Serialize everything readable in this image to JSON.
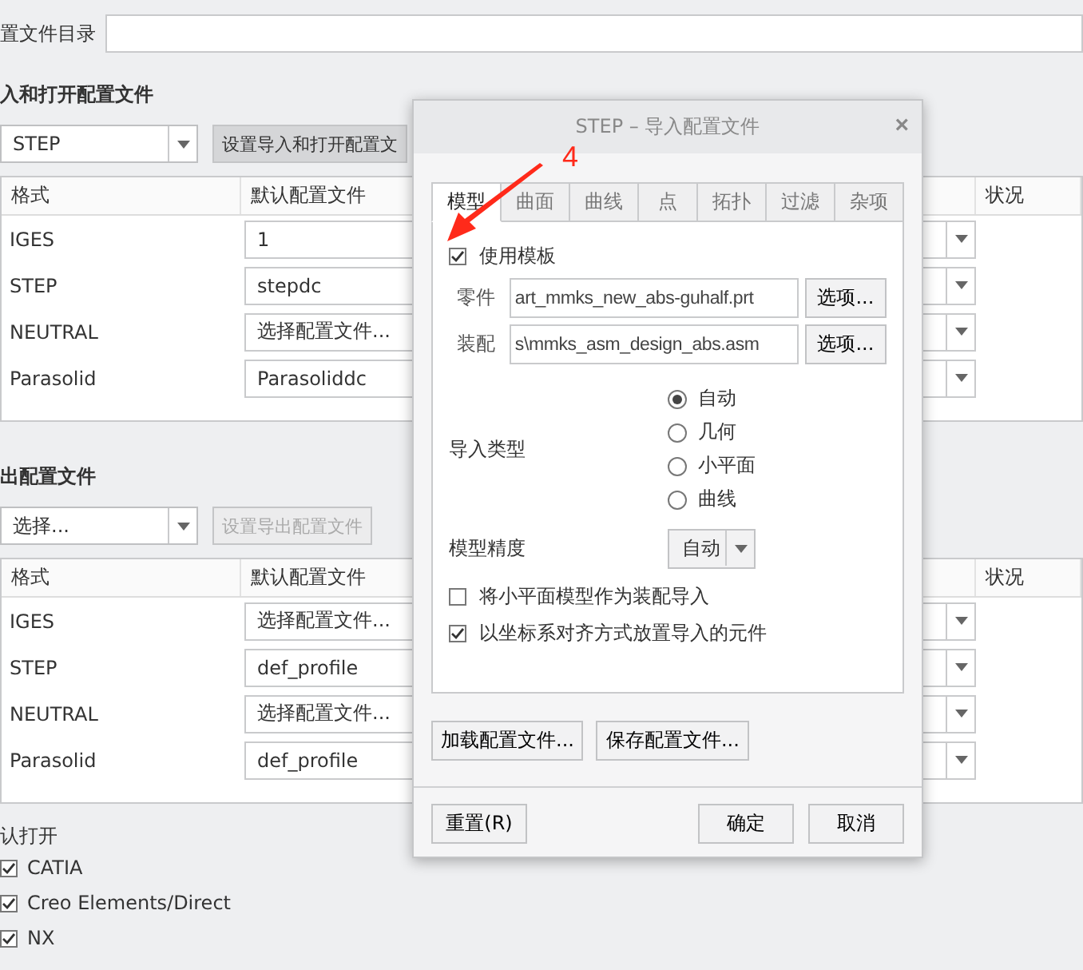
{
  "background": {
    "directory_label": "置文件目录",
    "import_section": {
      "heading": "入和打开配置文件",
      "format_select": "STEP",
      "setup_button": {
        "label": "设置导入和打开配置文",
        "disabled": false
      },
      "columns": [
        "格式",
        "默认配置文件",
        "状况"
      ],
      "rows": [
        {
          "format": "IGES",
          "profile": "1"
        },
        {
          "format": "STEP",
          "profile": "stepdc"
        },
        {
          "format": "NEUTRAL",
          "profile": "选择配置文件..."
        },
        {
          "format": "Parasolid",
          "profile": "Parasoliddc"
        }
      ]
    },
    "export_section": {
      "heading": "出配置文件",
      "format_select": "选择...",
      "setup_button": {
        "label": "设置导出配置文件",
        "disabled": true
      },
      "columns": [
        "格式",
        "默认配置文件",
        "状况"
      ],
      "rows": [
        {
          "format": "IGES",
          "profile": "选择配置文件..."
        },
        {
          "format": "STEP",
          "profile": "def_profile"
        },
        {
          "format": "NEUTRAL",
          "profile": "选择配置文件..."
        },
        {
          "format": "Parasolid",
          "profile": "def_profile"
        }
      ]
    },
    "open_section": {
      "heading": "认打开",
      "items": [
        {
          "label": "CATIA",
          "checked": true
        },
        {
          "label": "Creo Elements/Direct",
          "checked": true
        },
        {
          "label": "NX",
          "checked": true
        }
      ]
    }
  },
  "dialog": {
    "title": "STEP – 导入配置文件",
    "close": "×",
    "tabs": [
      {
        "label": "模型",
        "selected": true
      },
      {
        "label": "曲面",
        "selected": false
      },
      {
        "label": "曲线",
        "selected": false
      },
      {
        "label": "点",
        "selected": false
      },
      {
        "label": "拓扑",
        "selected": false
      },
      {
        "label": "过滤",
        "selected": false
      },
      {
        "label": "杂项",
        "selected": false
      }
    ],
    "use_template": {
      "label": "使用模板",
      "checked": true
    },
    "template_fields": [
      {
        "label": "零件",
        "value": "art_mmks_new_abs-guhalf.prt",
        "button": "选项..."
      },
      {
        "label": "装配",
        "value": "s\\mmks_asm_design_abs.asm",
        "button": "选项..."
      }
    ],
    "import_type": {
      "label": "导入类型",
      "options": [
        {
          "label": "自动",
          "selected": true
        },
        {
          "label": "几何",
          "selected": false
        },
        {
          "label": "小平面",
          "selected": false
        },
        {
          "label": "曲线",
          "selected": false
        }
      ]
    },
    "model_precision": {
      "label": "模型精度",
      "value": "自动"
    },
    "options": [
      {
        "label": "将小平面模型作为装配导入",
        "checked": false
      },
      {
        "label": "以坐标系对齐方式放置导入的元件",
        "checked": true
      }
    ],
    "profile_buttons": [
      "加载配置文件...",
      "保存配置文件..."
    ],
    "footer": {
      "reset": "重置(R)",
      "ok": "确定",
      "cancel": "取消"
    }
  },
  "annotation": {
    "number": "4"
  }
}
